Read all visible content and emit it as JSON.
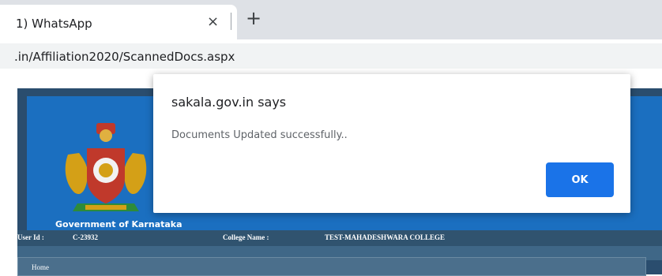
{
  "browser": {
    "tab": {
      "title": "1) WhatsApp",
      "close_glyph": "×"
    },
    "new_tab_glyph": "+",
    "url": ".in/Affiliation2020/ScannedDocs.aspx"
  },
  "page": {
    "government_text": "Government of Karnataka",
    "user_id_label": "User Id :",
    "user_id_value": "C-23932",
    "college_name_label": "College Name :",
    "college_name_value": "TEST-MAHADESHWARA COLLEGE",
    "nav_home": "Home",
    "colors": {
      "banner": "#1b6fc0",
      "frame": "#2a4d6e"
    }
  },
  "dialog": {
    "title": "sakala.gov.in says",
    "message": "Documents Updated successfully..",
    "ok_label": "OK",
    "accent": "#1a73e8"
  },
  "icons": [
    "close-icon",
    "plus-icon",
    "state-emblem-icon"
  ]
}
